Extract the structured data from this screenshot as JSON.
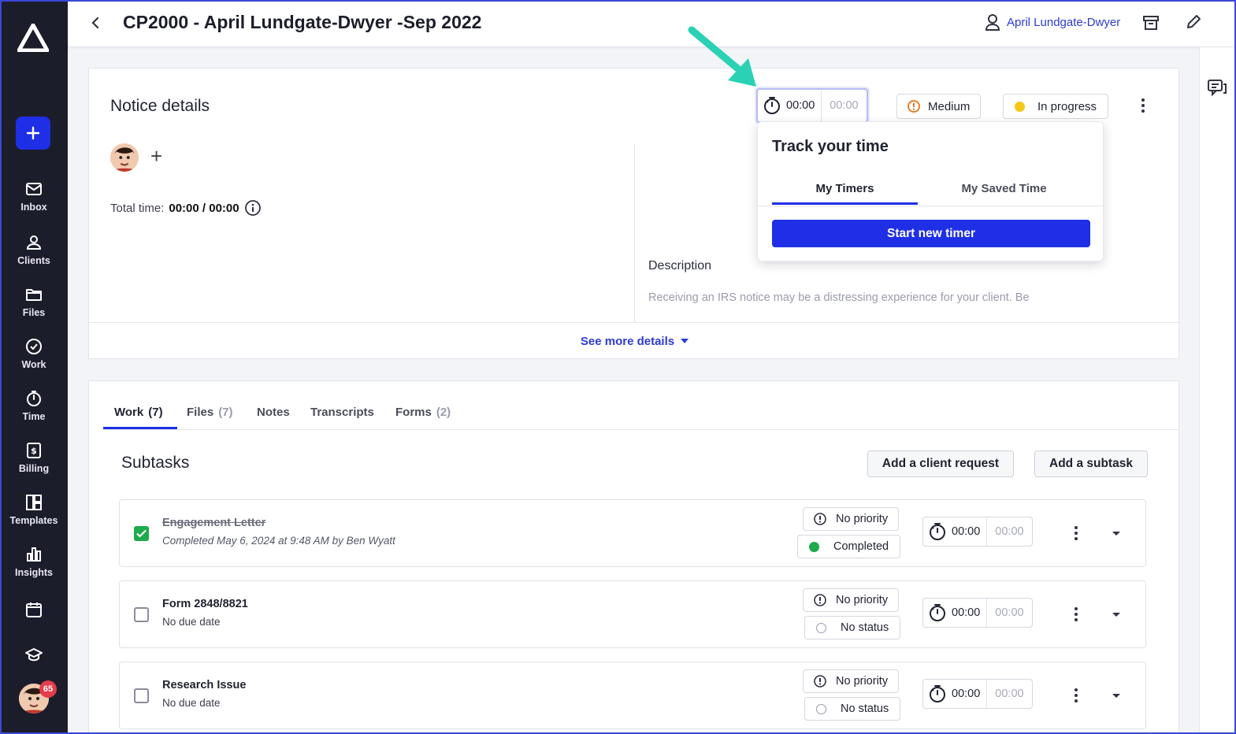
{
  "sidebar": {
    "new_label": "+",
    "items": [
      {
        "label": "Inbox",
        "icon": "inbox-icon"
      },
      {
        "label": "Clients",
        "icon": "clients-icon"
      },
      {
        "label": "Files",
        "icon": "folder-icon"
      },
      {
        "label": "Work",
        "icon": "check-circle-icon"
      },
      {
        "label": "Time",
        "icon": "timer-icon"
      },
      {
        "label": "Billing",
        "icon": "billing-icon"
      },
      {
        "label": "Templates",
        "icon": "templates-icon"
      },
      {
        "label": "Insights",
        "icon": "bar-chart-icon"
      }
    ],
    "notification_count": "65"
  },
  "header": {
    "title": "CP2000 - April Lundgate-Dwyer -Sep 2022",
    "client_name": "April Lundgate-Dwyer"
  },
  "notice": {
    "title": "Notice details",
    "timer_running": "00:00",
    "timer_saved": "00:00",
    "priority": "Medium",
    "status": "In progress",
    "total_time_label": "Total time:",
    "total_time_value": "00:00 / 00:00",
    "description_label": "Description",
    "description_text": "Receiving an IRS notice may be a distressing experience for your client. Be",
    "see_more": "See more details"
  },
  "popover": {
    "title": "Track your time",
    "tab_active": "My Timers",
    "tab_inactive": "My Saved Time",
    "button": "Start new timer"
  },
  "tabs": [
    {
      "label": "Work",
      "count": "(7)"
    },
    {
      "label": "Files",
      "count": "(7)"
    },
    {
      "label": "Notes",
      "count": ""
    },
    {
      "label": "Transcripts",
      "count": ""
    },
    {
      "label": "Forms",
      "count": "(2)"
    }
  ],
  "subtasks": {
    "title": "Subtasks",
    "add_client_request": "Add a client request",
    "add_subtask": "Add a subtask",
    "rows": [
      {
        "title": "Engagement Letter",
        "subtitle": "Completed May 6, 2024 at 9:48 AM by Ben Wyatt",
        "priority": "No priority",
        "status": "Completed",
        "timer": "00:00",
        "saved": "00:00",
        "checked": true
      },
      {
        "title": "Form 2848/8821",
        "subtitle": "No due date",
        "priority": "No priority",
        "status": "No status",
        "timer": "00:00",
        "saved": "00:00",
        "checked": false
      },
      {
        "title": "Research Issue",
        "subtitle": "No due date",
        "priority": "No priority",
        "status": "No status",
        "timer": "00:00",
        "saved": "00:00",
        "checked": false
      }
    ]
  },
  "colors": {
    "accent": "#1e2fe6",
    "sidebar_bg": "#1c1d2b",
    "status_in_progress": "#f5c816",
    "status_completed": "#1faa4c",
    "priority_medium": "#e8731b",
    "annotation_arrow": "#2ad1b5"
  }
}
